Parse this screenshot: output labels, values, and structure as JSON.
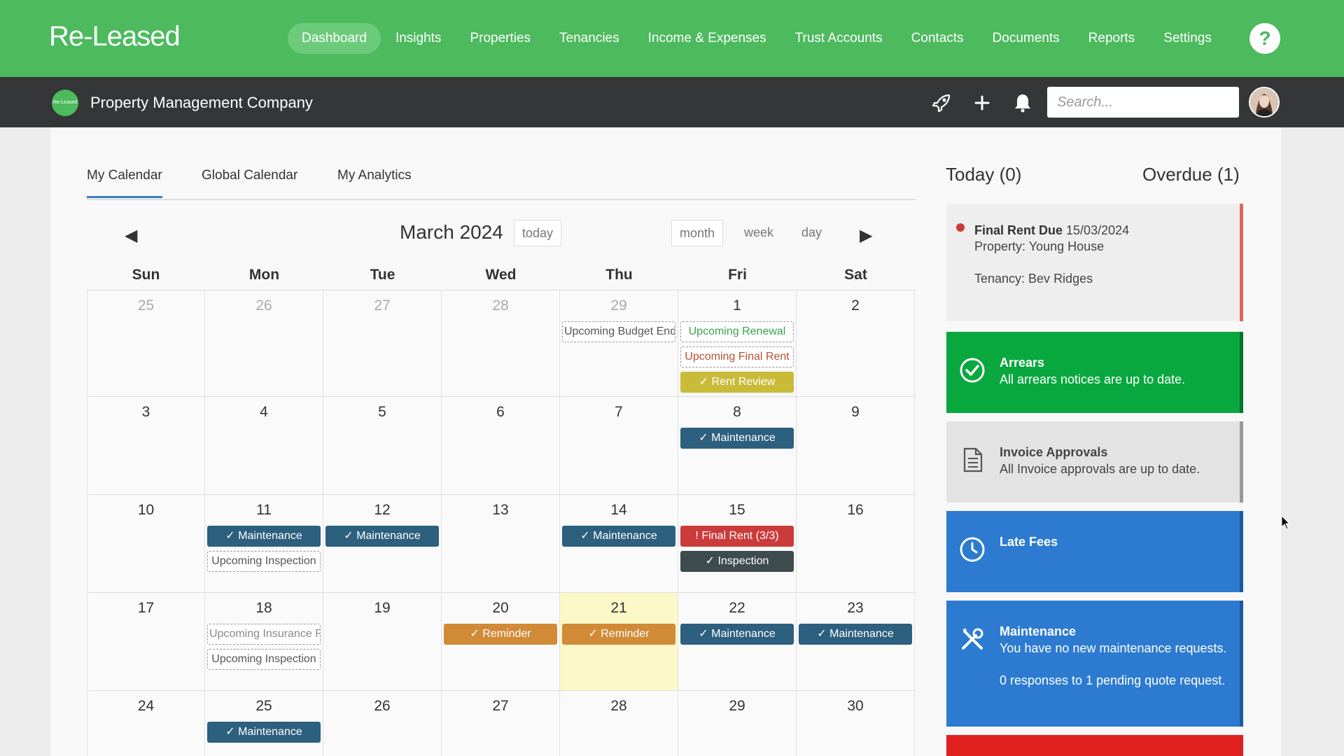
{
  "app": {
    "logo": "Re-Leased"
  },
  "nav": {
    "items": [
      "Dashboard",
      "Insights",
      "Properties",
      "Tenancies",
      "Income & Expenses",
      "Trust Accounts",
      "Contacts",
      "Documents",
      "Reports",
      "Settings"
    ],
    "active": "Dashboard",
    "help": "?"
  },
  "subbar": {
    "company_logo_text": "Re-Leased",
    "company": "Property Management Company",
    "search_placeholder": "Search..."
  },
  "tabs": [
    "My Calendar",
    "Global Calendar",
    "My Analytics"
  ],
  "calendar": {
    "title": "March 2024",
    "today_button": "today",
    "views": [
      "month",
      "week",
      "day"
    ],
    "prev": "◀",
    "next": "▶",
    "days_of_week": [
      "Sun",
      "Mon",
      "Tue",
      "Wed",
      "Thu",
      "Fri",
      "Sat"
    ],
    "weeks": [
      [
        "25",
        "26",
        "27",
        "28",
        "29",
        "1",
        "2"
      ],
      [
        "3",
        "4",
        "5",
        "6",
        "7",
        "8",
        "9"
      ],
      [
        "10",
        "11",
        "12",
        "13",
        "14",
        "15",
        "16"
      ],
      [
        "17",
        "18",
        "19",
        "20",
        "21",
        "22",
        "23"
      ],
      [
        "24",
        "25",
        "26",
        "27",
        "28",
        "29",
        "30"
      ]
    ],
    "events": {
      "upcoming_budget_end": "Upcoming Budget End",
      "upcoming_renewal": "Upcoming Renewal",
      "upcoming_final_rent": "Upcoming Final Rent",
      "rent_review": "✓ Rent Review",
      "maintenance": "✓ Maintenance",
      "upcoming_inspection": "Upcoming Inspection",
      "final_rent": "! Final Rent (3/3)",
      "inspection": "✓ Inspection",
      "reminder": "✓ Reminder",
      "upcoming_insurance_renewal": "Upcoming Insurance Renewal"
    }
  },
  "sidebar": {
    "today": "Today (0)",
    "overdue": "Overdue (1)",
    "overdue_item": {
      "title": "Final Rent Due",
      "date": "15/03/2024",
      "property": "Property: Young House",
      "tenancy": "Tenancy: Bev Ridges"
    },
    "cards": {
      "arrears": {
        "title": "Arrears",
        "text": "All arrears notices are up to date."
      },
      "invoice": {
        "title": "Invoice Approvals",
        "text": "All Invoice approvals are up to date."
      },
      "late_fees": {
        "title": "Late Fees"
      },
      "maintenance": {
        "title": "Maintenance",
        "text1": "You have no new maintenance requests.",
        "text2": "0 responses to 1 pending quote request."
      }
    }
  },
  "colors": {
    "brand_green": "#4cba5d",
    "dark_bar": "#343638",
    "maintenance": "#2d5f7e",
    "reminder": "#d18a36",
    "final_rent": "#cc3b3b",
    "arrears_card": "#09a83e",
    "info_card": "#2c7bd0"
  }
}
